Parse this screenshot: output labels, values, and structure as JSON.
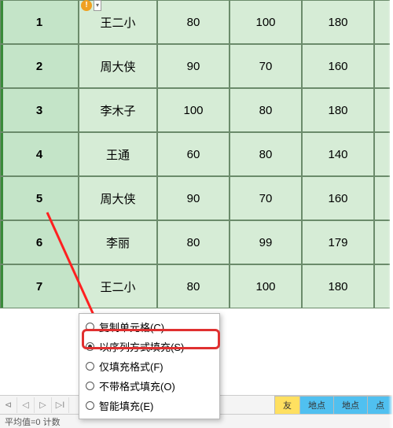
{
  "rows": [
    {
      "idx": "1",
      "name": "王二小",
      "a": "80",
      "b": "100",
      "c": "180"
    },
    {
      "idx": "2",
      "name": "周大侠",
      "a": "90",
      "b": "70",
      "c": "160"
    },
    {
      "idx": "3",
      "name": "李木子",
      "a": "100",
      "b": "80",
      "c": "180"
    },
    {
      "idx": "4",
      "name": "王通",
      "a": "60",
      "b": "80",
      "c": "140"
    },
    {
      "idx": "5",
      "name": "周大侠",
      "a": "90",
      "b": "70",
      "c": "160"
    },
    {
      "idx": "6",
      "name": "李丽",
      "a": "80",
      "b": "99",
      "c": "179"
    },
    {
      "idx": "7",
      "name": "王二小",
      "a": "80",
      "b": "100",
      "c": "180"
    }
  ],
  "smarttag": {
    "glyph": "!"
  },
  "autofill": {
    "options": [
      {
        "key": "copy",
        "label": "复制单元格(C)",
        "selected": false
      },
      {
        "key": "series",
        "label": "以序列方式填充(S)",
        "selected": true
      },
      {
        "key": "format",
        "label": "仅填充格式(F)",
        "selected": false
      },
      {
        "key": "noformat",
        "label": "不带格式填充(O)",
        "selected": false
      },
      {
        "key": "smart",
        "label": "智能填充(E)",
        "selected": false
      }
    ]
  },
  "tabs": {
    "items": [
      {
        "label": "友",
        "cls": "alt"
      },
      {
        "label": "地点",
        "cls": ""
      },
      {
        "label": "地点",
        "cls": ""
      },
      {
        "label": "点",
        "cls": ""
      }
    ]
  },
  "status": {
    "text": "平均值=0  计数"
  },
  "nav": {
    "first": "⊲",
    "prev": "◁",
    "next": "▷",
    "last": "▷I"
  }
}
